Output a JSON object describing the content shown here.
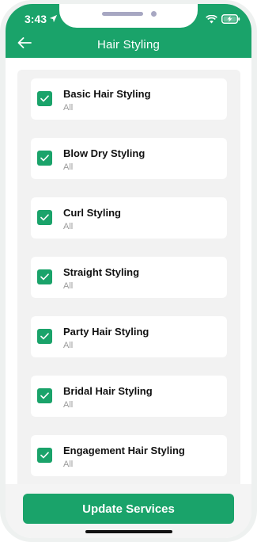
{
  "status_bar": {
    "time": "3:43",
    "location_icon": "location-arrow-icon",
    "wifi_icon": "wifi-icon",
    "battery_icon": "battery-charging-icon"
  },
  "header": {
    "title": "Hair Styling",
    "back_icon": "arrow-left-icon",
    "color": "#1aa36a"
  },
  "services": [
    {
      "name": "Basic Hair Styling",
      "sub": "All",
      "checked": true
    },
    {
      "name": "Blow Dry Styling",
      "sub": "All",
      "checked": true
    },
    {
      "name": "Curl Styling",
      "sub": "All",
      "checked": true
    },
    {
      "name": "Straight Styling",
      "sub": "All",
      "checked": true
    },
    {
      "name": "Party Hair Styling",
      "sub": "All",
      "checked": true
    },
    {
      "name": "Bridal Hair Styling",
      "sub": "All",
      "checked": true
    },
    {
      "name": "Engagement Hair Styling",
      "sub": "All",
      "checked": true
    }
  ],
  "footer": {
    "update_label": "Update Services"
  }
}
